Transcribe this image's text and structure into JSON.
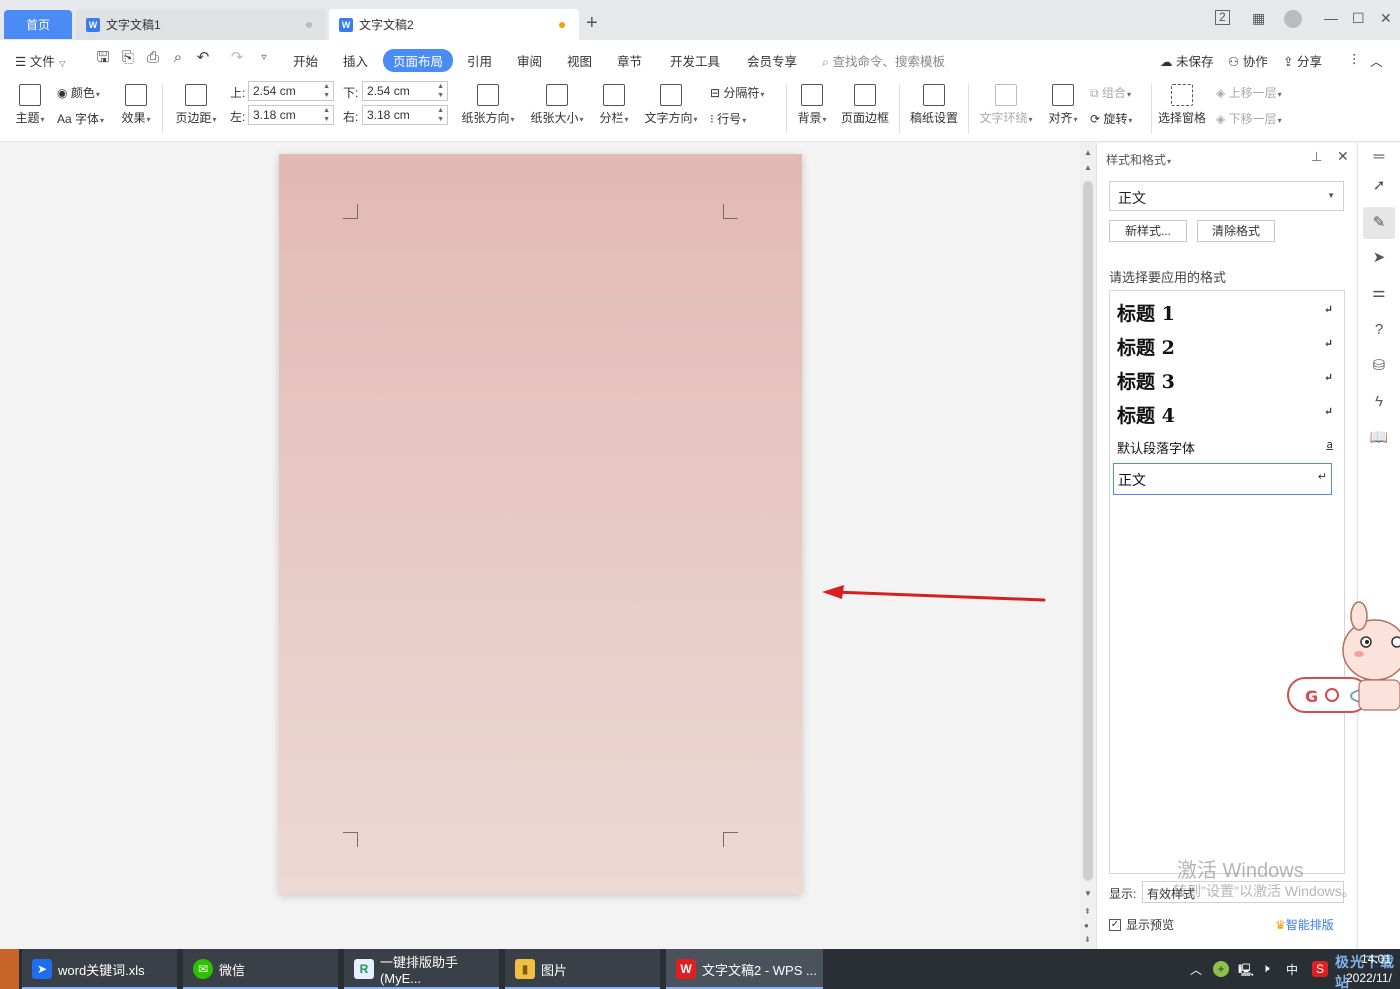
{
  "tabs": {
    "home": "首页",
    "doc1": "文字文稿1",
    "doc2": "文字文稿2"
  },
  "menu": {
    "file": "文件",
    "items": [
      "开始",
      "插入",
      "页面布局",
      "引用",
      "审阅",
      "视图",
      "章节",
      "开发工具",
      "会员专享"
    ],
    "active": "页面布局",
    "search": "查找命令、搜索模板",
    "unsaved": "未保存",
    "collab": "协作",
    "share": "分享"
  },
  "ribbon": {
    "theme": "主题",
    "color": "颜色",
    "font": "Aa 字体",
    "effect": "效果",
    "margin": "页边距",
    "top_label": "上:",
    "top_value": "2.54 cm",
    "bottom_label": "下:",
    "bottom_value": "2.54 cm",
    "left_label": "左:",
    "left_value": "3.18 cm",
    "right_label": "右:",
    "right_value": "3.18 cm",
    "orientation": "纸张方向",
    "size": "纸张大小",
    "columns": "分栏",
    "text_direction": "文字方向",
    "breaks": "分隔符",
    "line_numbers": "行号",
    "background": "背景",
    "page_border": "页面边框",
    "manuscript": "稿纸设置",
    "text_wrap": "文字环绕",
    "align": "对齐",
    "group": "组合",
    "rotate": "旋转",
    "select_pane": "选择窗格",
    "bring_forward": "上移一层",
    "send_backward": "下移一层"
  },
  "style_panel": {
    "title": "样式和格式",
    "current": "正文",
    "new_style": "新样式...",
    "clear_format": "清除格式",
    "prompt": "请选择要应用的格式",
    "styles": [
      {
        "label": "标题  1",
        "mark": "↵"
      },
      {
        "label": "标题  2",
        "mark": "↵"
      },
      {
        "label": "标题  3",
        "mark": "↵"
      },
      {
        "label": "标题  4",
        "mark": "↵"
      },
      {
        "label": "默认段落字体",
        "mark": "a"
      },
      {
        "label": "正文",
        "mark": "↵"
      }
    ],
    "show_label": "显示:",
    "show_value": "有效样式",
    "preview": "显示预览",
    "smart_layout": "智能排版",
    "activate_title": "激活 Windows",
    "activate_sub": "转到\"设置\"以激活 Windows。"
  },
  "taskbar": {
    "items": [
      "word关键词.xls",
      "微信",
      "一键排版助手(MyE...",
      "图片",
      "文字文稿2 - WPS ..."
    ],
    "time": "14:01",
    "date": "2022/11/",
    "ime": "中",
    "watermark": "极光下载站"
  },
  "colors": {
    "accent": "#4b8bf5",
    "page_top": "#e2b9b4",
    "page_bottom": "#edd8d4",
    "arrow": "#d62020",
    "taskbar": "#2a2f36"
  }
}
